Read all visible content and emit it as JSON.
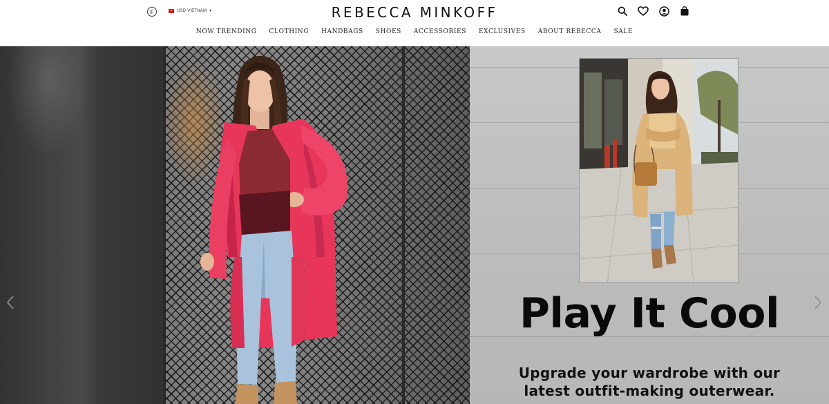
{
  "header": {
    "fm_badge": "F",
    "currency_label": "USD VIETNAM",
    "currency_caret": "▾",
    "brand_logo": "REBECCA MINKOFF",
    "icons": [
      "search-icon",
      "heart-icon",
      "account-icon",
      "bag-icon"
    ]
  },
  "nav": {
    "items": [
      {
        "label": "NOW TRENDING"
      },
      {
        "label": "CLOTHING"
      },
      {
        "label": "HANDBAGS"
      },
      {
        "label": "SHOES"
      },
      {
        "label": "ACCESSORIES"
      },
      {
        "label": "EXCLUSIVES"
      },
      {
        "label": "ABOUT REBECCA"
      },
      {
        "label": "SALE"
      }
    ]
  },
  "hero": {
    "headline": "Play It Cool",
    "subline_1": "Upgrade your wardrobe with our",
    "subline_2": "latest outfit-making outerwear.",
    "prev_icon": "chevron-left-icon",
    "next_icon": "chevron-right-icon"
  },
  "colors": {
    "coat_pink": "#e8365a",
    "sweater_burgundy": "#6b1a22",
    "jeans_blue": "#a9c3dc",
    "camel_coat": "#dcb37a",
    "text_dark": "#111111"
  }
}
